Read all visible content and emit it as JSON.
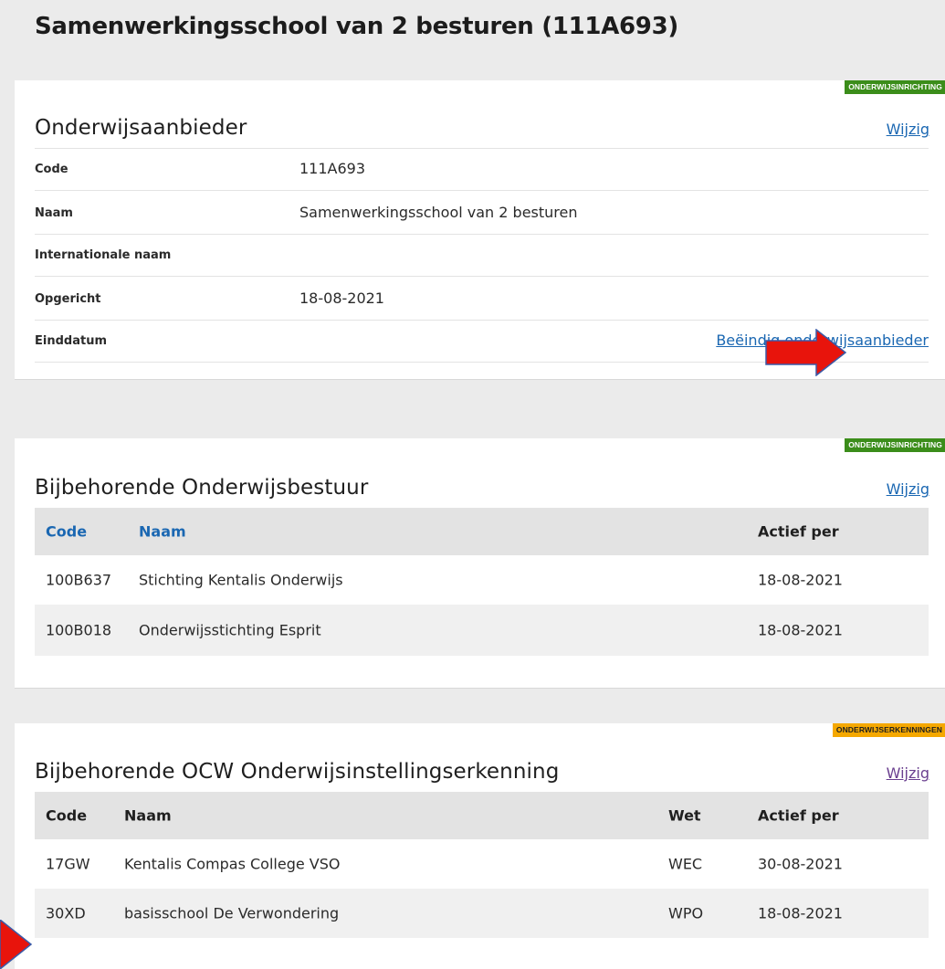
{
  "page": {
    "title": "Samenwerkingsschool van 2 besturen (111A693)"
  },
  "aanbieder": {
    "badge": "ONDERWIJSINRICHTING",
    "title": "Onderwijsaanbieder",
    "edit_label": "Wijzig",
    "fields": [
      {
        "label": "Code",
        "value": "111A693"
      },
      {
        "label": "Naam",
        "value": "Samenwerkingsschool van 2 besturen"
      },
      {
        "label": "Internationale naam",
        "value": ""
      },
      {
        "label": "Opgericht",
        "value": "18-08-2021"
      },
      {
        "label": "Einddatum",
        "value": ""
      }
    ],
    "end_link": "Beëindig onderwijsaanbieder"
  },
  "bestuur": {
    "badge": "ONDERWIJSINRICHTING",
    "title": "Bijbehorende Onderwijsbestuur",
    "edit_label": "Wijzig",
    "columns": {
      "code": "Code",
      "naam": "Naam",
      "actief": "Actief per"
    },
    "rows": [
      {
        "code": "100B637",
        "naam": "Stichting Kentalis Onderwijs",
        "actief": "18-08-2021"
      },
      {
        "code": "100B018",
        "naam": "Onderwijsstichting Esprit",
        "actief": "18-08-2021"
      }
    ]
  },
  "erkenning": {
    "badge": "ONDERWIJSERKENNINGEN",
    "title": "Bijbehorende OCW Onderwijsinstellingserkenning",
    "edit_label": "Wijzig",
    "columns": {
      "code": "Code",
      "naam": "Naam",
      "wet": "Wet",
      "actief": "Actief per"
    },
    "rows": [
      {
        "code": "17GW",
        "naam": "Kentalis Compas College VSO",
        "wet": "WEC",
        "actief": "30-08-2021"
      },
      {
        "code": "30XD",
        "naam": "basisschool De Verwondering",
        "wet": "WPO",
        "actief": "18-08-2021"
      }
    ]
  },
  "colors": {
    "badge_green": "#3b8d1a",
    "badge_orange": "#f5a800",
    "link_blue": "#1a67b2",
    "annotation_red": "#e8140c"
  }
}
